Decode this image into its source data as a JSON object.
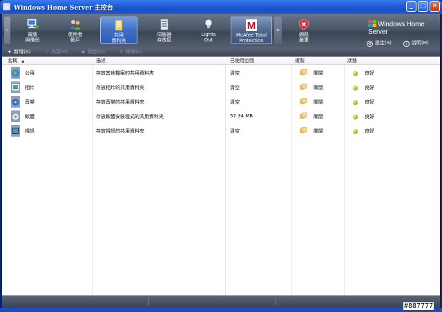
{
  "window": {
    "title": "Windows Home Server 主控台",
    "min_glyph": "_",
    "max_glyph": "□",
    "close_glyph": "✕"
  },
  "nav": {
    "tabs": [
      {
        "line1": "電腦",
        "line2": "與備份",
        "icon": "computers-backup-icon"
      },
      {
        "line1": "使用者",
        "line2": "帳戶",
        "icon": "user-accounts-icon"
      },
      {
        "line1": "共用",
        "line2": "資料夾",
        "icon": "shared-folders-icon",
        "active": true
      },
      {
        "line1": "伺服器",
        "line2": "存放區",
        "icon": "server-storage-icon"
      },
      {
        "line1": "Lights",
        "line2": "Out",
        "icon": "lightbulb-icon"
      },
      {
        "line1": "McAfee Total",
        "line2": "Protection",
        "icon": "mcafee-icon"
      },
      {
        "line1": "網路",
        "line2": "嚴重",
        "icon": "network-critical-icon"
      }
    ],
    "scroll_left_glyph": "‹",
    "scroll_right_glyph": "»",
    "brand": "Windows Home Server",
    "settings_label": "設定(S)",
    "help_label": "說明(H)"
  },
  "toolbar": {
    "add_label": "新增(A)",
    "properties_label": "內容(P)",
    "open_label": "開啟(O)",
    "remove_label": "移除(E)"
  },
  "table": {
    "columns": [
      "名稱",
      "描述",
      "已使用空間",
      "複製",
      "狀態"
    ],
    "sort_glyph": "▲",
    "rows": [
      {
        "name": "公用",
        "description": "存放其他檔案的共用資料夾",
        "used": "清空",
        "duplication": "關閉",
        "status": "良好"
      },
      {
        "name": "相片",
        "description": "存放相片的共用資料夾",
        "used": "清空",
        "duplication": "關閉",
        "status": "良好"
      },
      {
        "name": "音樂",
        "description": "存放音樂的共用資料夾",
        "used": "清空",
        "duplication": "關閉",
        "status": "良好"
      },
      {
        "name": "軟體",
        "description": "存放軟體安裝程式的共用資料夾",
        "used": "57.34 MB",
        "duplication": "關閉",
        "status": "良好"
      },
      {
        "name": "視訊",
        "description": "存放視訊的共用資料夾",
        "used": "清空",
        "duplication": "關閉",
        "status": "良好"
      }
    ]
  },
  "watermark": "#887777",
  "colors": {
    "titlebar": "#1f5fd8",
    "ribbon": "#4a5566",
    "active_tab": "#3f6fc2",
    "status_good": "#8cbf1a"
  }
}
